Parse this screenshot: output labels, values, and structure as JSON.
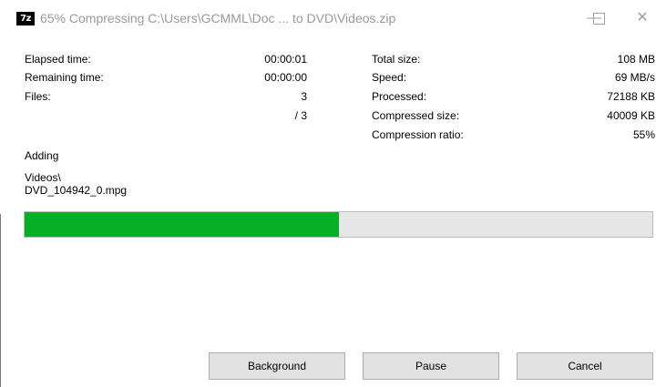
{
  "window": {
    "icon_text": "7z",
    "title": "65% Compressing C:\\Users\\GCMML\\Doc ... to DVD\\Videos.zip",
    "controls": {
      "minimize": "—",
      "maximize": "☐",
      "close": "✕"
    }
  },
  "stats_left": [
    {
      "label": "Elapsed time:",
      "value": "00:00:01"
    },
    {
      "label": "Remaining time:",
      "value": "00:00:00"
    },
    {
      "label": "Files:",
      "value": "3"
    },
    {
      "label": "",
      "value": "/ 3"
    }
  ],
  "stats_right": [
    {
      "label": "Total size:",
      "value": "108 MB"
    },
    {
      "label": "Speed:",
      "value": "69 MB/s"
    },
    {
      "label": "Processed:",
      "value": "72188 KB"
    },
    {
      "label": "Compressed size:",
      "value": "40009 KB"
    },
    {
      "label": "Compression ratio:",
      "value": "55%"
    }
  ],
  "status": {
    "action": "Adding",
    "folder": "Videos\\",
    "file": "DVD_104942_0.mpg"
  },
  "progress": {
    "percent": 50,
    "color": "#06b025"
  },
  "buttons": {
    "background": "Background",
    "pause": "Pause",
    "cancel": "Cancel"
  }
}
